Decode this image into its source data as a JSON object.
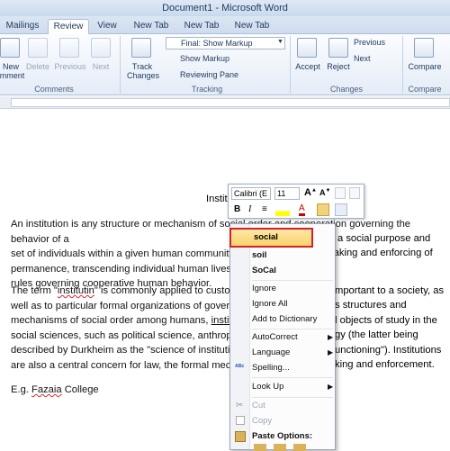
{
  "window": {
    "title": "Document1 - Microsoft Word"
  },
  "tabs": [
    "Mailings",
    "Review",
    "View",
    "New Tab",
    "New Tab",
    "New Tab"
  ],
  "ribbon": {
    "comments": {
      "new_label": "New",
      "new_sub": "omment",
      "delete": "Delete",
      "previous": "Previous",
      "next": "Next",
      "group": "Comments"
    },
    "tracking": {
      "track_changes": "Track",
      "track_changes_sub": "Changes",
      "markup_select": "Final: Show Markup",
      "show_markup": "Show Markup",
      "reviewing_pane": "Reviewing Pane",
      "group": "Tracking"
    },
    "changes": {
      "accept": "Accept",
      "reject": "Reject",
      "previous": "Previous",
      "next": "Next",
      "group": "Changes"
    },
    "compare": {
      "label": "Compare",
      "label2": "Compare"
    }
  },
  "document": {
    "heading_fragment": "Instit",
    "p1_lines": [
      "An institution is any structure or mechanism of social order and cooperation governing the behavior of a",
      "set of individuals within a given human community.",
      "permanence, transcending individual human lives a",
      "rules governing cooperative human behavior."
    ],
    "p1_right": [
      "with a social purpose and",
      "e making and enforcing of"
    ],
    "p2_lines": [
      "The term \"",
      "\" is commonly applied to custom",
      "well as to particular formal organizations of governn",
      "mechanisms of social order among humans, ",
      "social sciences, such as political science, anthropolo",
      "described by Durkheim as the \"science of institution",
      "are also a central concern for law, the formal mecha"
    ],
    "p2_misspelled": "institutin",
    "p2_link": "institut",
    "p2_right": [
      "mportant to a society, as",
      "s structures and",
      "l objects of study in the",
      "gy (the latter being",
      "unctioning\").  Institutions",
      "king and enforcement."
    ],
    "p3_prefix": "E.g. ",
    "p3_link": "Fazaia",
    "p3_suffix": " College"
  },
  "minitoolbar": {
    "font": "Calibri (E",
    "size": "11",
    "bold": "B",
    "italic": "I",
    "font_color_icon": "A"
  },
  "context_menu": {
    "suggestions": [
      "social",
      "soil",
      "SoCal"
    ],
    "items": [
      "Ignore",
      "Ignore All",
      "Add to Dictionary",
      "AutoCorrect",
      "Language",
      "Spelling...",
      "Look Up",
      "Cut",
      "Copy",
      "Paste Options:"
    ],
    "highlighted": "social"
  },
  "colors": {
    "highlight_border": "#d4202a",
    "ribbon_bg": "#e4ecf7",
    "squiggle": "#dd2233"
  }
}
